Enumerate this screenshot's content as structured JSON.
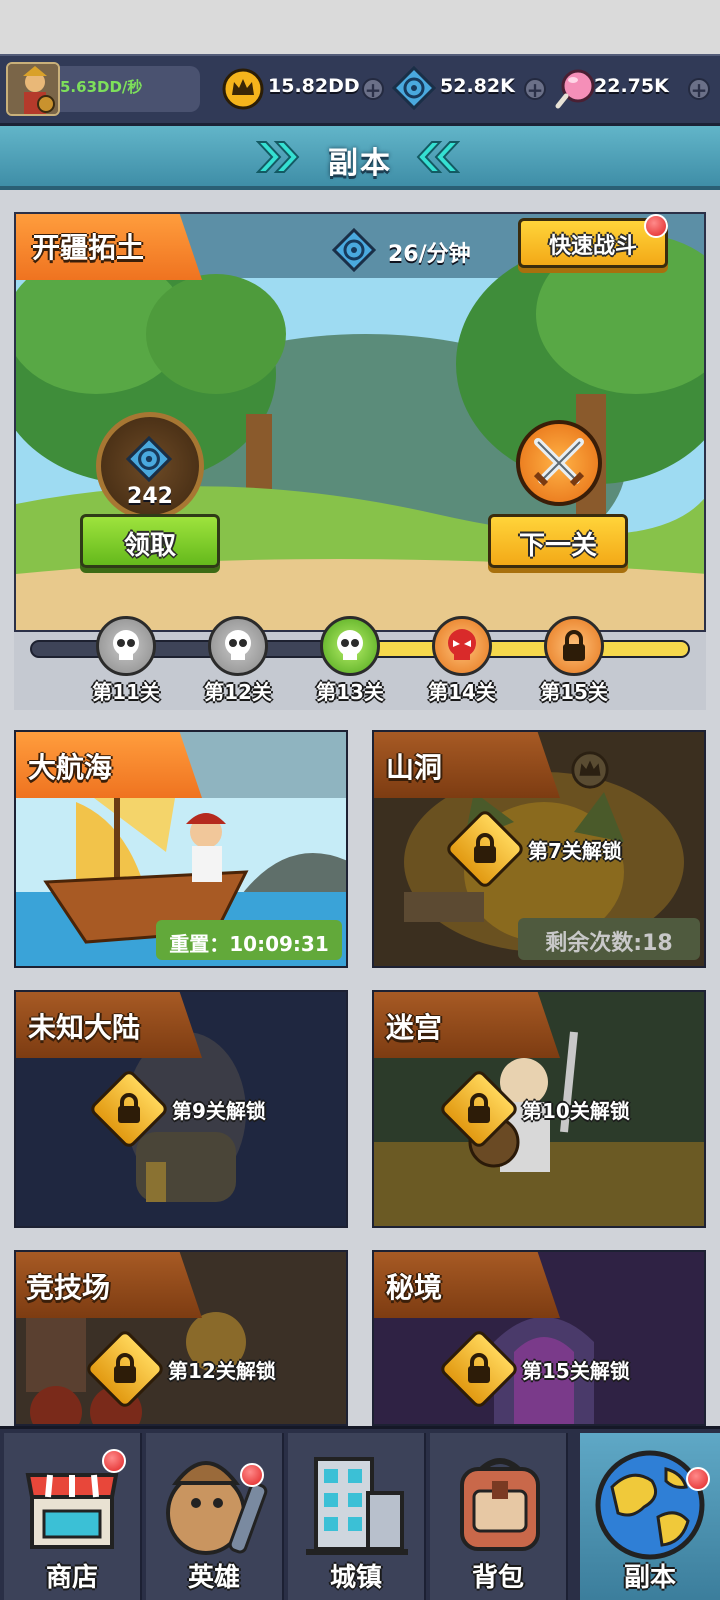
{
  "topbar": {
    "income": "5.63DD/秒",
    "gold": "15.82DD",
    "gems": "52.82K",
    "candy": "22.75K"
  },
  "banner": {
    "title": "副本"
  },
  "feature": {
    "name": "开疆拓土",
    "rate": "26/分钟",
    "quick_battle": "快速战斗",
    "reward_amount": "242",
    "claim_label": "领取",
    "next_label": "下一关"
  },
  "stages": [
    {
      "label": "第11关",
      "state": "cleared"
    },
    {
      "label": "第12关",
      "state": "cleared"
    },
    {
      "label": "第13关",
      "state": "current"
    },
    {
      "label": "第14关",
      "state": "boss"
    },
    {
      "label": "第15关",
      "state": "locked"
    }
  ],
  "dungeons": [
    {
      "name": "大航海",
      "reset": "重置：10:09:31"
    },
    {
      "name": "山洞",
      "unlock": "第7关解锁",
      "remaining": "剩余次数:18"
    },
    {
      "name": "未知大陆",
      "unlock": "第9关解锁"
    },
    {
      "name": "迷宫",
      "unlock": "第10关解锁"
    },
    {
      "name": "竞技场",
      "unlock": "第12关解锁"
    },
    {
      "name": "秘境",
      "unlock": "第15关解锁"
    }
  ],
  "nav": [
    {
      "label": "商店",
      "icon": "shop-icon"
    },
    {
      "label": "英雄",
      "icon": "hero-icon"
    },
    {
      "label": "城镇",
      "icon": "town-icon"
    },
    {
      "label": "背包",
      "icon": "backpack-icon"
    },
    {
      "label": "副本",
      "icon": "globe-icon"
    }
  ],
  "colors": {
    "accent_orange": "#ef7320",
    "accent_green": "#65b91c",
    "accent_yellow": "#f3a917",
    "bar_dark": "#313a57"
  }
}
